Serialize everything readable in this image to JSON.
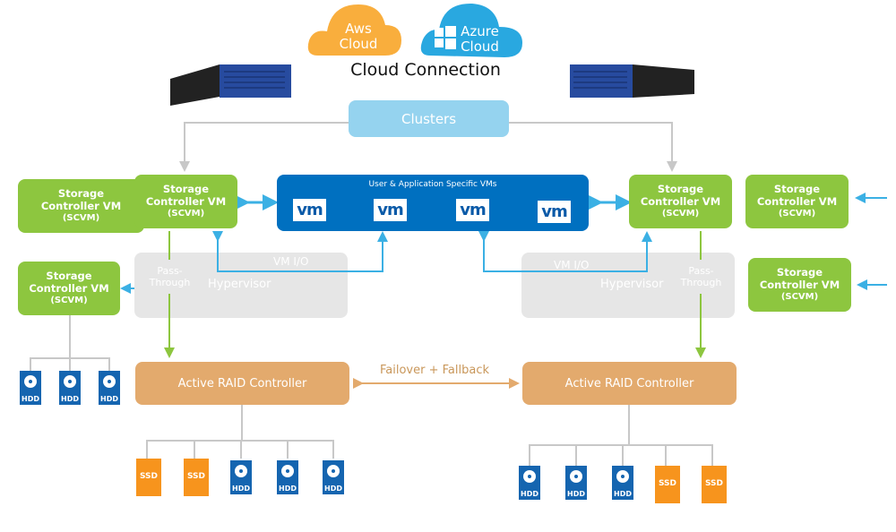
{
  "clouds": {
    "aws": "Aws\nCloud",
    "aws_l1": "Aws",
    "aws_l2": "Cloud",
    "azure_l1": "Azure",
    "azure_l2": "Cloud",
    "title": "Cloud Connection"
  },
  "clusters": "Clusters",
  "scvm": {
    "l1": "Storage",
    "l2": "Controller VM",
    "l3": "(SCVM)"
  },
  "vms": {
    "title": "User & Application Specific VMs",
    "logo": "vm"
  },
  "hypervisor": {
    "label": "Hypervisor",
    "vmio": "VM I/O",
    "pass1": "Pass-",
    "pass2": "Through"
  },
  "raid": "Active RAID Controller",
  "failover": "Failover + Fallback",
  "drives": {
    "hdd": "HDD",
    "ssd": "SSD"
  },
  "colors": {
    "scvm": "#8dc63f",
    "vm_box": "#0070c0",
    "clusters": "#95d3ef",
    "raid": "#e3aa6d",
    "hypervisor": "#e6e6e6",
    "aws": "#f9ae3d",
    "azure": "#29a8e0",
    "arrow": "#3bb0e4",
    "ssd": "#f7941d",
    "hdd": "#1565b0"
  }
}
